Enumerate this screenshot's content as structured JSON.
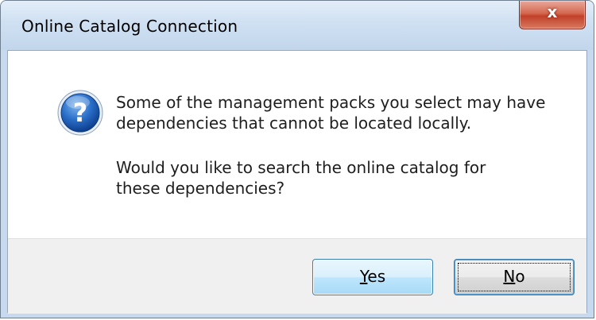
{
  "window": {
    "title": "Online Catalog Connection",
    "close_glyph": "x"
  },
  "icon": {
    "name": "question-icon",
    "glyph": "?",
    "color": "#1f5fb8"
  },
  "message": {
    "line1": "Some of the management packs you select may have",
    "line2": "dependencies that cannot be located locally.",
    "line3": "Would you like to search the online catalog for",
    "line4": "these dependencies?"
  },
  "buttons": {
    "yes": {
      "mnemonic": "Y",
      "rest": "es"
    },
    "no": {
      "mnemonic": "N",
      "rest": "o"
    }
  }
}
